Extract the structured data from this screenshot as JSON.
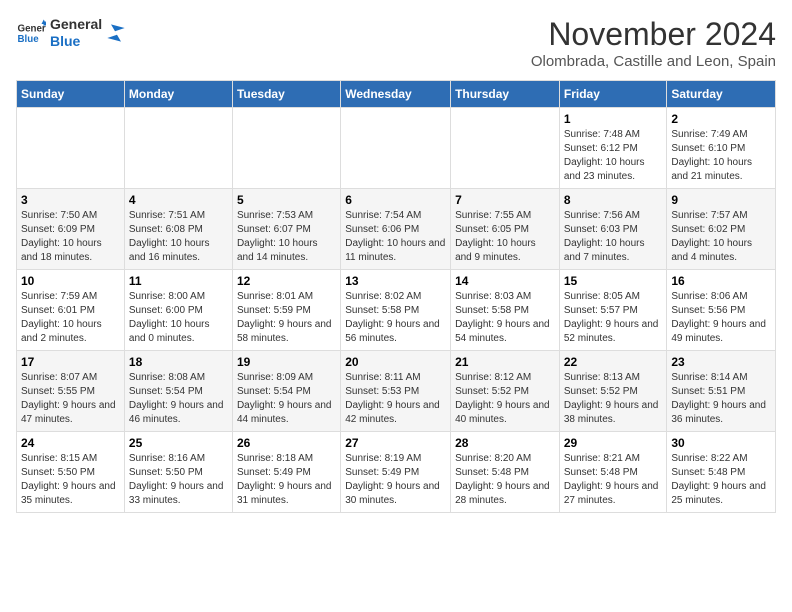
{
  "logo": {
    "line1": "General",
    "line2": "Blue"
  },
  "title": "November 2024",
  "subtitle": "Olombrada, Castille and Leon, Spain",
  "headers": [
    "Sunday",
    "Monday",
    "Tuesday",
    "Wednesday",
    "Thursday",
    "Friday",
    "Saturday"
  ],
  "weeks": [
    [
      {
        "day": "",
        "info": ""
      },
      {
        "day": "",
        "info": ""
      },
      {
        "day": "",
        "info": ""
      },
      {
        "day": "",
        "info": ""
      },
      {
        "day": "",
        "info": ""
      },
      {
        "day": "1",
        "info": "Sunrise: 7:48 AM\nSunset: 6:12 PM\nDaylight: 10 hours and 23 minutes."
      },
      {
        "day": "2",
        "info": "Sunrise: 7:49 AM\nSunset: 6:10 PM\nDaylight: 10 hours and 21 minutes."
      }
    ],
    [
      {
        "day": "3",
        "info": "Sunrise: 7:50 AM\nSunset: 6:09 PM\nDaylight: 10 hours and 18 minutes."
      },
      {
        "day": "4",
        "info": "Sunrise: 7:51 AM\nSunset: 6:08 PM\nDaylight: 10 hours and 16 minutes."
      },
      {
        "day": "5",
        "info": "Sunrise: 7:53 AM\nSunset: 6:07 PM\nDaylight: 10 hours and 14 minutes."
      },
      {
        "day": "6",
        "info": "Sunrise: 7:54 AM\nSunset: 6:06 PM\nDaylight: 10 hours and 11 minutes."
      },
      {
        "day": "7",
        "info": "Sunrise: 7:55 AM\nSunset: 6:05 PM\nDaylight: 10 hours and 9 minutes."
      },
      {
        "day": "8",
        "info": "Sunrise: 7:56 AM\nSunset: 6:03 PM\nDaylight: 10 hours and 7 minutes."
      },
      {
        "day": "9",
        "info": "Sunrise: 7:57 AM\nSunset: 6:02 PM\nDaylight: 10 hours and 4 minutes."
      }
    ],
    [
      {
        "day": "10",
        "info": "Sunrise: 7:59 AM\nSunset: 6:01 PM\nDaylight: 10 hours and 2 minutes."
      },
      {
        "day": "11",
        "info": "Sunrise: 8:00 AM\nSunset: 6:00 PM\nDaylight: 10 hours and 0 minutes."
      },
      {
        "day": "12",
        "info": "Sunrise: 8:01 AM\nSunset: 5:59 PM\nDaylight: 9 hours and 58 minutes."
      },
      {
        "day": "13",
        "info": "Sunrise: 8:02 AM\nSunset: 5:58 PM\nDaylight: 9 hours and 56 minutes."
      },
      {
        "day": "14",
        "info": "Sunrise: 8:03 AM\nSunset: 5:58 PM\nDaylight: 9 hours and 54 minutes."
      },
      {
        "day": "15",
        "info": "Sunrise: 8:05 AM\nSunset: 5:57 PM\nDaylight: 9 hours and 52 minutes."
      },
      {
        "day": "16",
        "info": "Sunrise: 8:06 AM\nSunset: 5:56 PM\nDaylight: 9 hours and 49 minutes."
      }
    ],
    [
      {
        "day": "17",
        "info": "Sunrise: 8:07 AM\nSunset: 5:55 PM\nDaylight: 9 hours and 47 minutes."
      },
      {
        "day": "18",
        "info": "Sunrise: 8:08 AM\nSunset: 5:54 PM\nDaylight: 9 hours and 46 minutes."
      },
      {
        "day": "19",
        "info": "Sunrise: 8:09 AM\nSunset: 5:54 PM\nDaylight: 9 hours and 44 minutes."
      },
      {
        "day": "20",
        "info": "Sunrise: 8:11 AM\nSunset: 5:53 PM\nDaylight: 9 hours and 42 minutes."
      },
      {
        "day": "21",
        "info": "Sunrise: 8:12 AM\nSunset: 5:52 PM\nDaylight: 9 hours and 40 minutes."
      },
      {
        "day": "22",
        "info": "Sunrise: 8:13 AM\nSunset: 5:52 PM\nDaylight: 9 hours and 38 minutes."
      },
      {
        "day": "23",
        "info": "Sunrise: 8:14 AM\nSunset: 5:51 PM\nDaylight: 9 hours and 36 minutes."
      }
    ],
    [
      {
        "day": "24",
        "info": "Sunrise: 8:15 AM\nSunset: 5:50 PM\nDaylight: 9 hours and 35 minutes."
      },
      {
        "day": "25",
        "info": "Sunrise: 8:16 AM\nSunset: 5:50 PM\nDaylight: 9 hours and 33 minutes."
      },
      {
        "day": "26",
        "info": "Sunrise: 8:18 AM\nSunset: 5:49 PM\nDaylight: 9 hours and 31 minutes."
      },
      {
        "day": "27",
        "info": "Sunrise: 8:19 AM\nSunset: 5:49 PM\nDaylight: 9 hours and 30 minutes."
      },
      {
        "day": "28",
        "info": "Sunrise: 8:20 AM\nSunset: 5:48 PM\nDaylight: 9 hours and 28 minutes."
      },
      {
        "day": "29",
        "info": "Sunrise: 8:21 AM\nSunset: 5:48 PM\nDaylight: 9 hours and 27 minutes."
      },
      {
        "day": "30",
        "info": "Sunrise: 8:22 AM\nSunset: 5:48 PM\nDaylight: 9 hours and 25 minutes."
      }
    ]
  ]
}
